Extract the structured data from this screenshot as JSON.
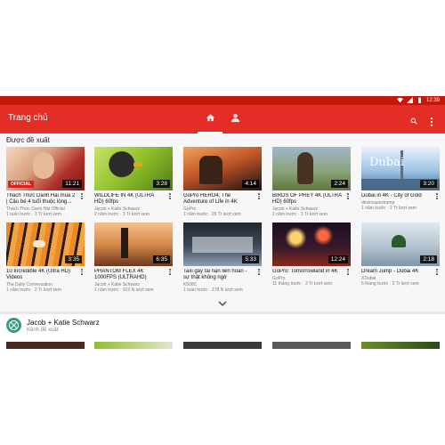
{
  "status": {
    "time": "12:39"
  },
  "appbar": {
    "title": "Trang chủ"
  },
  "section": {
    "title": "Được đề xuất"
  },
  "videos": [
    {
      "title": "Thách Thức Danh Hài mùa 2 | Cậu bé 4 tuổi thuộc lòng...",
      "channel": "Thách Thức Danh Hài Official",
      "meta": "1 tuần trước · 3 Tr lượt xem",
      "duration": "11:21",
      "badge": "OFFICIAL"
    },
    {
      "title": "WILDLIFE IN 4K (ULTRA HD) 60fps",
      "channel": "Jacob + Katie Schwarz",
      "meta": "2 năm trước · 3 Tr lượt xem",
      "duration": "3:28"
    },
    {
      "title": "GoPro HERO4: The Adventure of Life in 4K",
      "channel": "GoPro",
      "meta": "1 năm trước · 26 Tr lượt xem",
      "duration": "4:14"
    },
    {
      "title": "BIRDS OF PREY 4K (ULTRA HD) 60fps",
      "channel": "Jacob + Katie Schwarz",
      "meta": "1 năm trước · 1 Tr lượt xem",
      "duration": "2:24"
    },
    {
      "title": "Dubai in 4K - City of Gold",
      "channel": "devinsupertramp",
      "meta": "1 năm trước · 2 Tr lượt xem",
      "duration": "3:20",
      "badge": "Dubai"
    },
    {
      "title": "10 Incredible 4K (Ultra HD) Videos",
      "channel": "The Daily Conversation",
      "meta": "1 năm trước · 2 Tr lượt xem",
      "duration": "3:35"
    },
    {
      "title": "PHANTOM FLEX 4K 1000FPS (ULTRAHD)",
      "channel": "Jacob + Katie Schwarz",
      "meta": "1 năm trước · 923 N lượt xem",
      "duration": "6:35"
    },
    {
      "title": "Taxi gây tai nạn liên hoàn - sự thật không ngờ",
      "channel": "K508C",
      "meta": "1 tuần trước · 278 N lượt xem",
      "duration": "5:33"
    },
    {
      "title": "GoPro: Tomorrowland in 4K",
      "channel": "GoPro",
      "meta": "11 tháng trước · 2 Tr lượt xem",
      "duration": "12:24"
    },
    {
      "title": "Dream Jump - Dubai 4K",
      "channel": "XDubai",
      "meta": "6 tháng trước · 2 Tr lượt xem",
      "duration": "2:18"
    }
  ],
  "channel_row": {
    "name": "Jacob + Katie Schwarz",
    "subtitle": "Kênh đề xuất"
  },
  "colors": {
    "statusbar": "#c4180b",
    "appbar": "#e52d27",
    "avatar": "#2fa36f"
  },
  "icons": {
    "home": "home-icon",
    "account": "account-icon",
    "search": "search-icon",
    "more": "more-vert-icon",
    "chevron": "chevron-down-icon"
  }
}
